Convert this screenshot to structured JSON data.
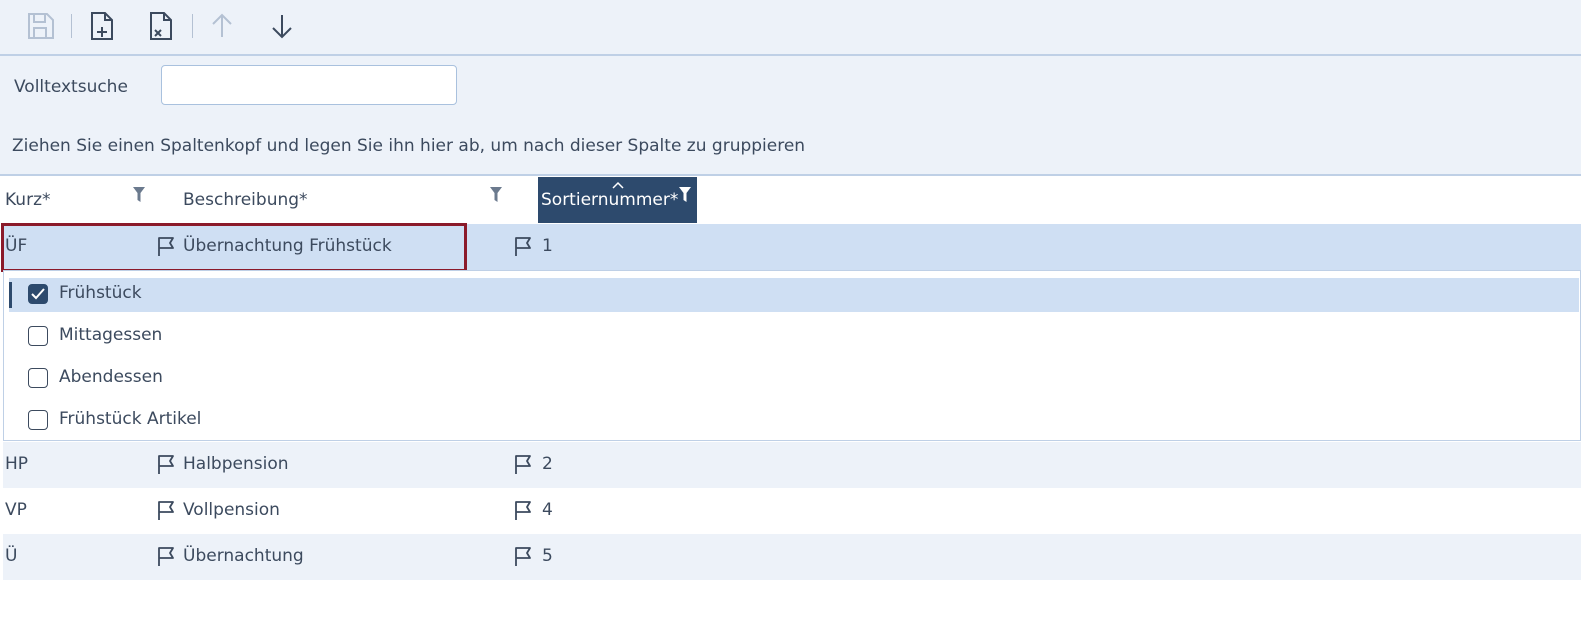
{
  "toolbar": {
    "buttons": [
      {
        "name": "save",
        "icon": "save-icon",
        "enabled": false
      },
      {
        "name": "new-record",
        "icon": "file-plus-icon",
        "enabled": true
      },
      {
        "name": "delete-record",
        "icon": "file-x-icon",
        "enabled": true
      },
      {
        "name": "move-up",
        "icon": "arrow-up-icon",
        "enabled": false
      },
      {
        "name": "move-down",
        "icon": "arrow-down-icon",
        "enabled": true
      }
    ]
  },
  "search": {
    "label": "Volltextsuche",
    "value": "",
    "placeholder": ""
  },
  "group_hint": "Ziehen Sie einen Spaltenkopf und legen Sie ihn hier ab, um nach dieser Spalte zu gruppieren",
  "columns": {
    "kurz": "Kurz*",
    "beschreibung": "Beschreibung*",
    "sortiernummer": "Sortiernummer*"
  },
  "rows": [
    {
      "kurz": "ÜF",
      "beschreibung": "Übernachtung Frühstück",
      "sortiernummer": "1"
    },
    {
      "kurz": "HP",
      "beschreibung": "Halbpension",
      "sortiernummer": "2"
    },
    {
      "kurz": "VP",
      "beschreibung": "Vollpension",
      "sortiernummer": "4"
    },
    {
      "kurz": "Ü",
      "beschreibung": "Übernachtung",
      "sortiernummer": "5"
    }
  ],
  "detail_options": [
    {
      "label": "Frühstück",
      "checked": true
    },
    {
      "label": "Mittagessen",
      "checked": false
    },
    {
      "label": "Abendessen",
      "checked": false
    },
    {
      "label": "Frühstück Artikel",
      "checked": false
    }
  ],
  "colors": {
    "accent": "#2d4a6d",
    "selection": "#cfdff3",
    "focus_border": "#8b1a2a",
    "panel": "#edf2f9"
  }
}
